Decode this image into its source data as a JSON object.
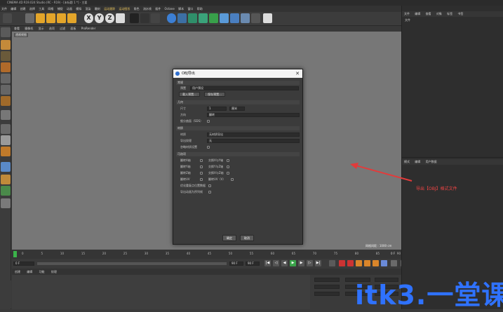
{
  "title_bar": {
    "text": "CINEMA 4D R19.024 Studio (RC - R19) - [未标题 1 *] - 主要"
  },
  "menu": {
    "items": [
      "文件",
      "编辑",
      "创建",
      "选择",
      "工具",
      "网格",
      "捕捉",
      "动画",
      "模拟",
      "渲染",
      "雕刻",
      "运动跟踪",
      "运动图形",
      "角色",
      "流水线",
      "插件",
      "Octane",
      "脚本",
      "窗口",
      "帮助"
    ],
    "highlight_index": 11
  },
  "toolbar": {
    "axis_buttons": [
      "X",
      "Y",
      "Z"
    ]
  },
  "viewport_menu": {
    "items": [
      "查看",
      "摄像机",
      "显示",
      "选项",
      "过滤",
      "面板",
      "ProRender"
    ]
  },
  "viewport": {
    "label": "透视视图",
    "grid_spacing": "网格间距 : 1000 cm"
  },
  "timeline": {
    "ticks": [
      "0",
      "5",
      "10",
      "15",
      "20",
      "25",
      "30",
      "35",
      "40",
      "45",
      "50",
      "55",
      "60",
      "65",
      "70",
      "75",
      "80",
      "85",
      "90"
    ],
    "end_frame": "0 F"
  },
  "playbar": {
    "current_frame": "0 F",
    "end_frame": "90 F",
    "end_frame2": "90 F"
  },
  "material_bar": {
    "items": [
      "创建",
      "编辑",
      "功能",
      "纹理"
    ]
  },
  "right_panel": {
    "top_tabs": [
      "文件",
      "编辑",
      "查看",
      "对象",
      "标签",
      "书签"
    ],
    "top_item": "文件",
    "bottom_tabs": [
      "模式",
      "编辑",
      "用户数据"
    ]
  },
  "dialog": {
    "title": "OBJ导出",
    "sections": {
      "general": "常规",
      "geometry": "几何",
      "material": "材质",
      "optimize": "可选项"
    },
    "general": {
      "preset_label": "预置",
      "preset_value": "用户预设",
      "load_button": "载入预置...",
      "save_button": "保存预置..."
    },
    "geometry": {
      "size_label": "尺寸",
      "size_value": "1",
      "size_unit": "厘米",
      "direction_label": "方向",
      "direction_value": "翻转",
      "sdk_label": "细分曲面（SDS）"
    },
    "material": {
      "material_label": "材质",
      "material_value": "无材质导出",
      "texture_label": "导出纹理",
      "texture_value": "无",
      "ignore_label": "忽略材质设置"
    },
    "options": {
      "row1_left": "翻转X轴",
      "row1_right": "交换X与Y轴",
      "row2_left": "翻转Y轴",
      "row2_right": "交换Y与Z轴",
      "row3_left": "翻转Z轴",
      "row3_right": "交换X与Z轴",
      "row4_left": "翻转UV",
      "row4_right": "翻转UV（V）",
      "row5": "优化重复点位置数据",
      "row6": "导出动画为序列帧"
    },
    "ok": "确定",
    "cancel": "取消"
  },
  "annotation": {
    "text": "导出【OBJ】格式文件",
    "color": "#e23b3b"
  },
  "watermark": {
    "text": "itk3.一堂课",
    "color": "#2f72ff"
  }
}
